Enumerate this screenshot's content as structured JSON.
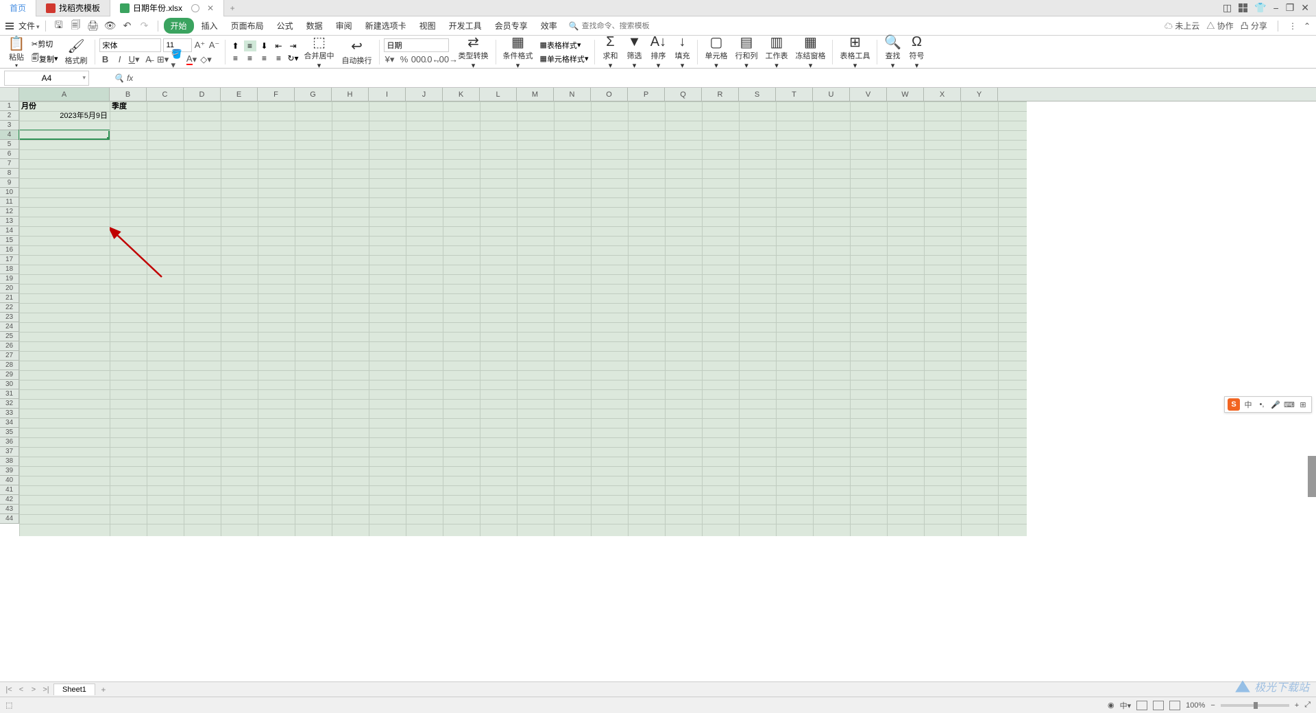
{
  "titlebar": {
    "home_tab": "首页",
    "template_tab": "找稻壳模板",
    "file_tab": "日期年份.xlsx",
    "window_controls": {
      "min": "−",
      "restore": "❐",
      "close": "✕"
    }
  },
  "menubar": {
    "file": "文件",
    "items": [
      "开始",
      "插入",
      "页面布局",
      "公式",
      "数据",
      "审阅",
      "新建选项卡",
      "视图",
      "开发工具",
      "会员专享",
      "效率"
    ],
    "search_placeholder": "查找命令、搜索模板",
    "cloud": "未上云",
    "collab": "协作",
    "share": "分享"
  },
  "ribbon": {
    "paste": "粘贴",
    "cut": "剪切",
    "copy": "复制",
    "format_painter": "格式刷",
    "font_name": "宋体",
    "font_size": "11",
    "merge": "合并居中",
    "wrap": "自动换行",
    "number_format": "日期",
    "type_convert": "类型转换",
    "cond_format": "条件格式",
    "table_style": "表格样式",
    "cell_style": "单元格样式",
    "sum": "求和",
    "filter": "筛选",
    "sort": "排序",
    "fill": "填充",
    "cell": "单元格",
    "rowcol": "行和列",
    "sheet": "工作表",
    "freeze": "冻结窗格",
    "table_tools": "表格工具",
    "find": "查找",
    "symbol": "符号"
  },
  "namebox": "A4",
  "formula": "",
  "columns": [
    "A",
    "B",
    "C",
    "D",
    "E",
    "F",
    "G",
    "H",
    "I",
    "J",
    "K",
    "L",
    "M",
    "N",
    "O",
    "P",
    "Q",
    "R",
    "S",
    "T",
    "U",
    "V",
    "W",
    "X",
    "Y"
  ],
  "cells": {
    "A1": "月份",
    "B1": "季度",
    "A2": "2023年5月9日"
  },
  "sheets": {
    "name": "Sheet1"
  },
  "statusbar": {
    "zoom": "100%"
  },
  "ime": {
    "lang": "中"
  },
  "watermark": "极光下载站"
}
